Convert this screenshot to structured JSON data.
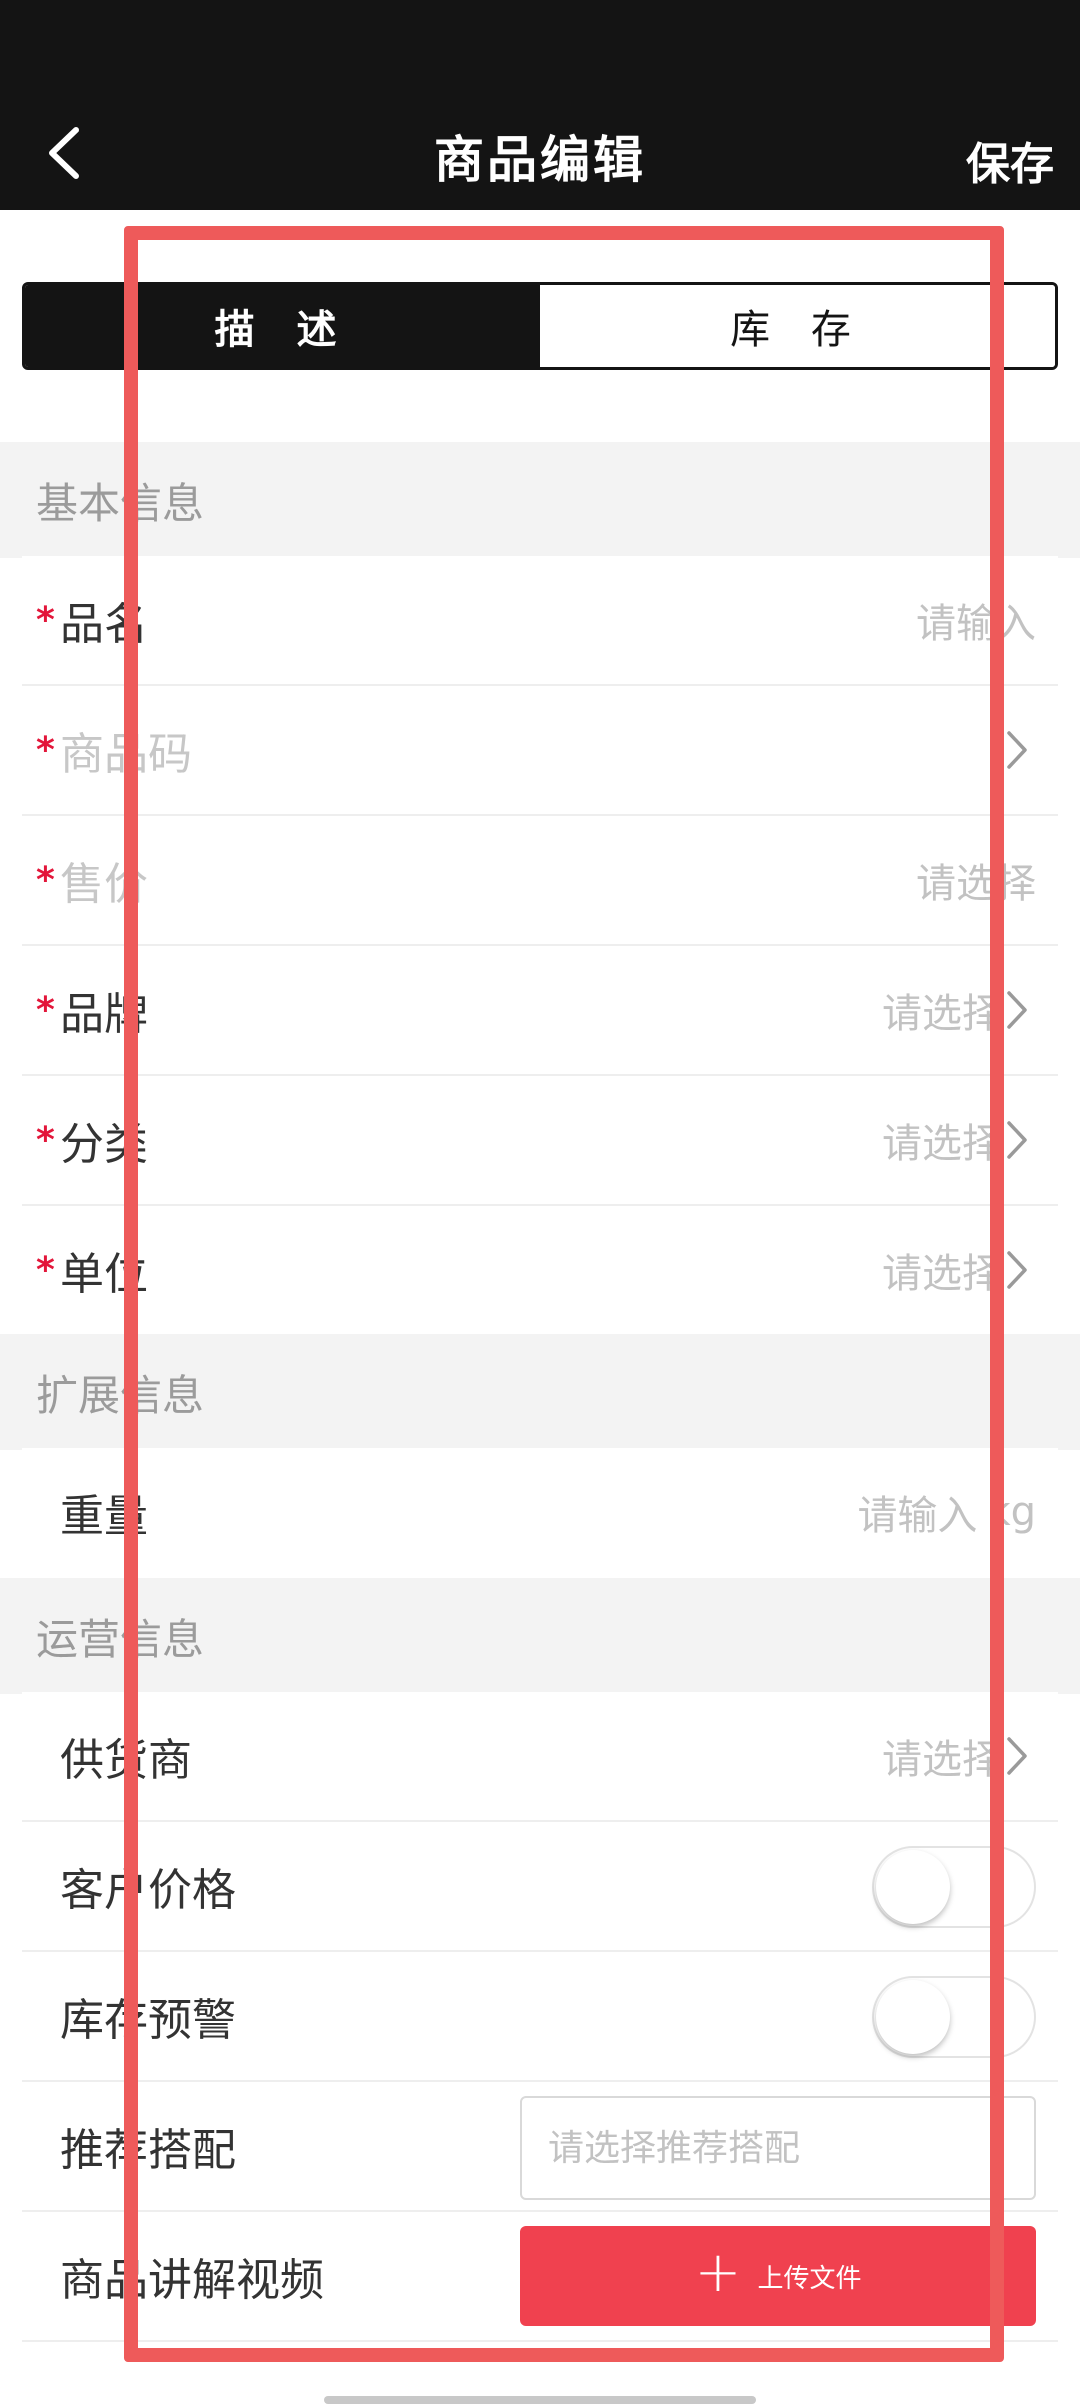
{
  "header": {
    "title": "商品编辑",
    "save_label": "保存"
  },
  "tabs": [
    {
      "label": "描 述",
      "active": true
    },
    {
      "label": "库 存",
      "active": false
    }
  ],
  "sections": {
    "basic": "基本信息",
    "extended": "扩展信息",
    "operations": "运营信息"
  },
  "required_mark": "*",
  "basic_fields": {
    "name": {
      "label": "品名",
      "value": "请输入"
    },
    "code": {
      "label": "商品码"
    },
    "price": {
      "label": "售价",
      "value": "请选择"
    },
    "brand": {
      "label": "品牌",
      "value": "请选择"
    },
    "category": {
      "label": "分类",
      "value": "请选择"
    },
    "unit": {
      "label": "单位",
      "value": "请选择"
    }
  },
  "extended_fields": {
    "weight": {
      "label": "重量",
      "value": "请输入",
      "unit": "kg"
    }
  },
  "operation_fields": {
    "supplier": {
      "label": "供货商",
      "value": "请选择"
    },
    "customer_price": {
      "label": "客户价格",
      "enabled": false
    },
    "stock_alert": {
      "label": "库存预警",
      "enabled": false
    },
    "recommend": {
      "label": "推荐搭配",
      "placeholder": "请选择推荐搭配"
    },
    "video": {
      "label": "商品讲解视频",
      "button": "上传文件"
    }
  },
  "colors": {
    "header_bg": "#141414",
    "required": "#e3163a",
    "upload_button": "#f0414f",
    "highlight_box": "#ee5a5a"
  },
  "icons": [
    "back-arrow-icon",
    "chevron-right-icon",
    "plus-icon"
  ]
}
